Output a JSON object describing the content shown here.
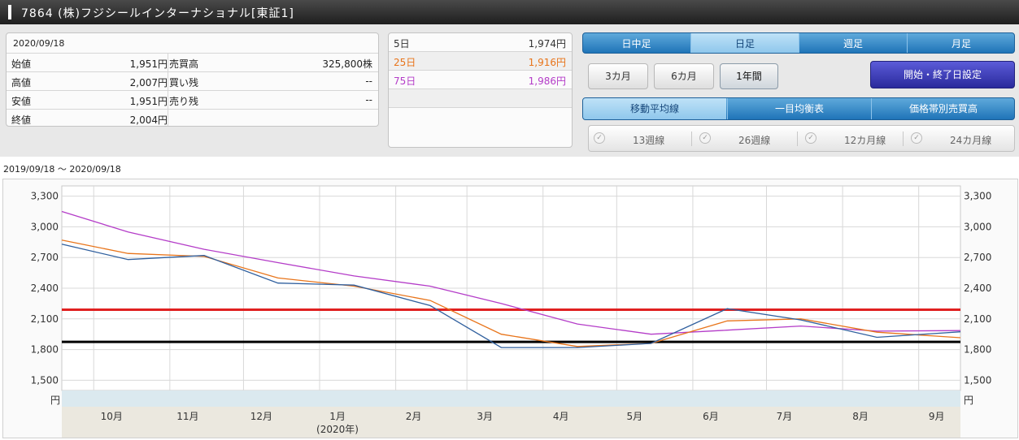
{
  "title": "7864 (株)フジシールインターナショナル[東証1]",
  "quote": {
    "date": "2020/09/18",
    "rows": [
      {
        "label": "始値",
        "value": "1,951円",
        "label2": "売買高",
        "value2": "325,800株"
      },
      {
        "label": "高値",
        "value": "2,007円",
        "label2": "買い残",
        "value2": "--"
      },
      {
        "label": "安値",
        "value": "1,951円",
        "label2": "売り残",
        "value2": "--"
      },
      {
        "label": "終値",
        "value": "2,004円",
        "label2": "",
        "value2": ""
      }
    ]
  },
  "moving_averages": [
    {
      "label": "5日",
      "value": "1,974円",
      "color": "#333333"
    },
    {
      "label": "25日",
      "value": "1,916円",
      "color": "#e8741a"
    },
    {
      "label": "75日",
      "value": "1,986円",
      "color": "#b43cc8"
    }
  ],
  "period_tabs": [
    "日中足",
    "日足",
    "週足",
    "月足"
  ],
  "period_selected": "日足",
  "range_buttons": [
    "3カ月",
    "6カ月",
    "1年間"
  ],
  "range_selected": "1年間",
  "date_range_button": "開始・終了日設定",
  "indicator_tabs": [
    "移動平均線",
    "一目均衡表",
    "価格帯別売買高"
  ],
  "indicator_selected": "移動平均線",
  "checkboxes": [
    "13週線",
    "26週線",
    "12カ月線",
    "24カ月線"
  ],
  "chart_range_label": "2019/09/18 〜 2020/09/18",
  "chart_data": {
    "type": "line",
    "title": "",
    "ylabel": "円",
    "y_ticks": [
      "3,300",
      "3,000",
      "2,700",
      "2,400",
      "2,100",
      "1,800",
      "1,500"
    ],
    "ylim": [
      1400,
      3400
    ],
    "x_ticks": [
      "10月",
      "11月",
      "12月",
      "1月",
      "2月",
      "3月",
      "4月",
      "5月",
      "6月",
      "7月",
      "8月",
      "9月"
    ],
    "x_sublabel": "(2020年)",
    "horizontal_lines": [
      {
        "value": 2190,
        "color": "#e02020"
      },
      {
        "value": 1875,
        "color": "#000000"
      }
    ],
    "series": [
      {
        "name": "75日",
        "color": "#b43cc8",
        "x": [
          "2019/09/18",
          "2019/10/15",
          "2019/11/15",
          "2019/12/15",
          "2020/01/15",
          "2020/02/15",
          "2020/03/15",
          "2020/04/15",
          "2020/05/15",
          "2020/06/15",
          "2020/07/15",
          "2020/08/15",
          "2020/09/18"
        ],
        "y": [
          3150,
          2950,
          2780,
          2650,
          2520,
          2420,
          2250,
          2050,
          1950,
          1990,
          2030,
          1980,
          1986
        ]
      },
      {
        "name": "25日",
        "color": "#e8741a",
        "x": [
          "2019/09/18",
          "2019/10/15",
          "2019/11/15",
          "2019/12/15",
          "2020/01/15",
          "2020/02/15",
          "2020/03/15",
          "2020/04/15",
          "2020/05/15",
          "2020/06/15",
          "2020/07/15",
          "2020/08/15",
          "2020/09/18"
        ],
        "y": [
          2870,
          2740,
          2710,
          2500,
          2420,
          2280,
          1950,
          1830,
          1860,
          2080,
          2100,
          1970,
          1916
        ]
      },
      {
        "name": "5日",
        "color": "#2f5f9e",
        "x": [
          "2019/09/18",
          "2019/10/15",
          "2019/11/15",
          "2019/12/15",
          "2020/01/15",
          "2020/02/15",
          "2020/03/15",
          "2020/04/15",
          "2020/05/15",
          "2020/06/15",
          "2020/07/15",
          "2020/08/15",
          "2020/09/18"
        ],
        "y": [
          2830,
          2680,
          2720,
          2450,
          2430,
          2230,
          1820,
          1820,
          1860,
          2200,
          2090,
          1920,
          1974
        ]
      }
    ]
  }
}
